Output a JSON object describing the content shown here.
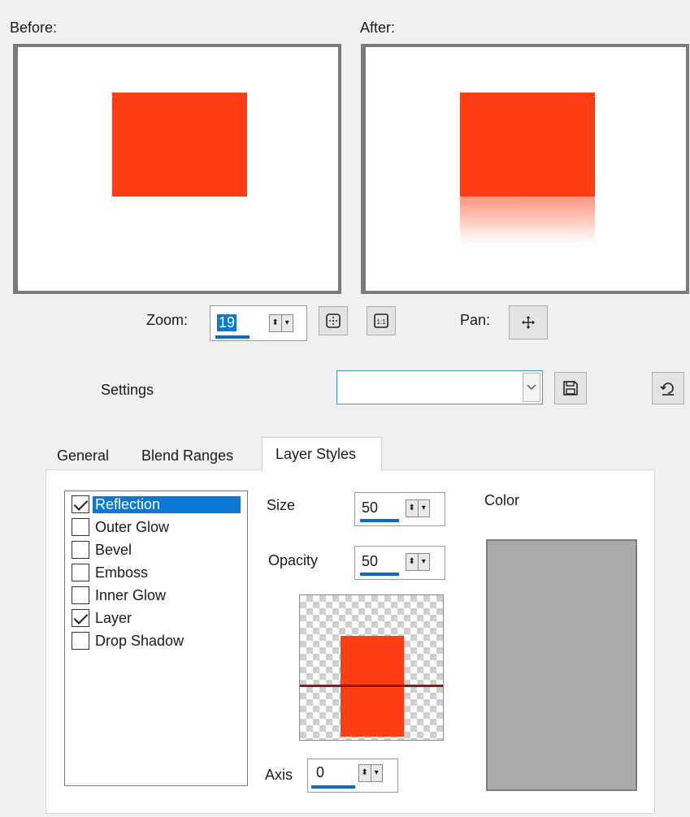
{
  "preview": {
    "before_label": "Before:",
    "after_label": "After:",
    "shape_color": "#ff3c12"
  },
  "zoom": {
    "label": "Zoom:",
    "value": "19",
    "fit_icon": "zoom-to-fit-icon",
    "actual_size_icon": "actual-size-icon"
  },
  "pan": {
    "label": "Pan:",
    "icon": "move-arrows-icon"
  },
  "settings": {
    "label": "Settings",
    "value": "",
    "save_icon": "save-disk-icon",
    "reset_icon": "reset-arrow-icon"
  },
  "tabs": [
    {
      "label": "General",
      "active": false
    },
    {
      "label": "Blend Ranges",
      "active": false
    },
    {
      "label": "Layer Styles",
      "active": true
    }
  ],
  "effects": [
    {
      "label": "Reflection",
      "checked": true,
      "selected": true
    },
    {
      "label": "Outer Glow",
      "checked": false,
      "selected": false
    },
    {
      "label": "Bevel",
      "checked": false,
      "selected": false
    },
    {
      "label": "Emboss",
      "checked": false,
      "selected": false
    },
    {
      "label": "Inner Glow",
      "checked": false,
      "selected": false
    },
    {
      "label": "Layer",
      "checked": true,
      "selected": false
    },
    {
      "label": "Drop Shadow",
      "checked": false,
      "selected": false
    }
  ],
  "reflection": {
    "size_label": "Size",
    "size_value": "50",
    "opacity_label": "Opacity",
    "opacity_value": "50",
    "axis_label": "Axis",
    "axis_value": "0",
    "color_label": "Color",
    "color_value": "#aaaaaa",
    "axis_line_color": "#8b1a1a"
  },
  "colors": {
    "accent": "#0a78d7",
    "shape": "#ff3c12"
  }
}
